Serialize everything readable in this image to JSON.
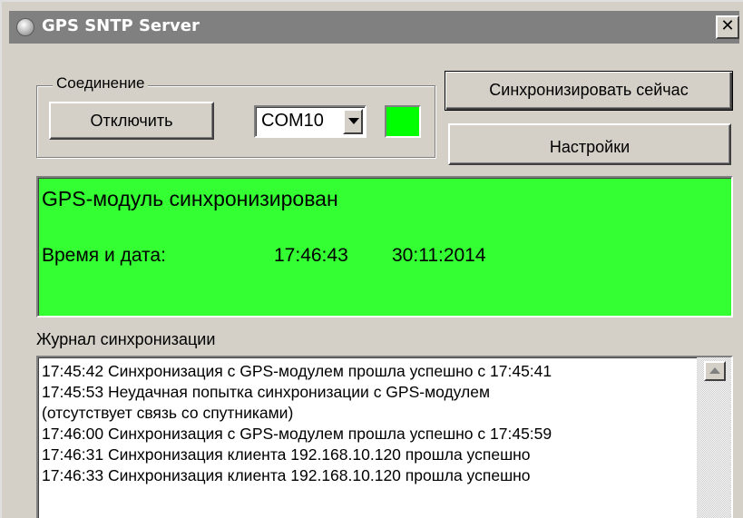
{
  "window": {
    "title": "GPS SNTP Server",
    "close_label": "✕"
  },
  "connection": {
    "group_label": "Соединение",
    "disconnect_label": "Отключить",
    "port_value": "COM10",
    "status_color": "#00ff00"
  },
  "actions": {
    "sync_now_label": "Синхронизировать сейчас",
    "settings_label": "Настройки"
  },
  "status": {
    "message": "GPS-модуль синхронизирован",
    "time_label": "Время и дата:",
    "time": "17:46:43",
    "date": "30:11:2014",
    "background_color": "#33ff33"
  },
  "log": {
    "label": "Журнал синхронизации",
    "lines": [
      "17:45:42  Синхронизация с GPS-модулем прошла успешно с 17:45:41",
      "17:45:53  Неудачная  попытка  синхронизации с GPS-модулем",
      "(отсутствует связь со спутниками)",
      "17:46:00  Синхронизация с GPS-модулем прошла успешно с 17:45:59",
      "17:46:31  Синхронизация клиента 192.168.10.120 прошла успешно",
      "17:46:33  Синхронизация клиента 192.168.10.120 прошла успешно"
    ]
  }
}
